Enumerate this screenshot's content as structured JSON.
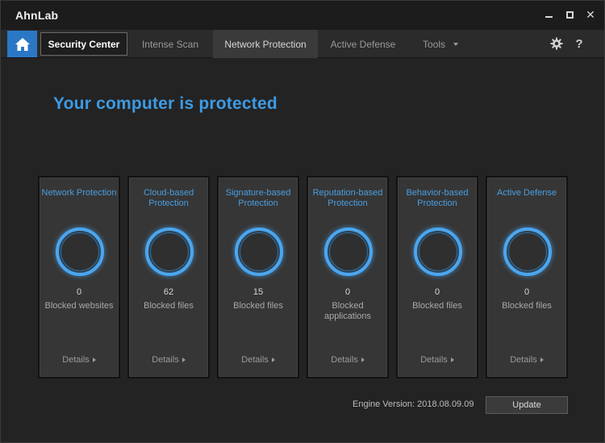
{
  "window": {
    "app_title": "AhnLab"
  },
  "nav": {
    "tabs": [
      "Security Center",
      "Intense Scan",
      "Network Protection",
      "Active Defense",
      "Tools"
    ],
    "active_tab": "Security Center",
    "hovered_tab": "Network Protection"
  },
  "main": {
    "headline": "Your computer is protected",
    "cards": [
      {
        "title": "Network Protection",
        "count": "0",
        "label": "Blocked websites",
        "details": "Details"
      },
      {
        "title": "Cloud-based Protection",
        "count": "62",
        "label": "Blocked files",
        "details": "Details"
      },
      {
        "title": "Signature-based Protection",
        "count": "15",
        "label": "Blocked files",
        "details": "Details"
      },
      {
        "title": "Reputation-based Protection",
        "count": "0",
        "label": "Blocked applications",
        "details": "Details"
      },
      {
        "title": "Behavior-based Protection",
        "count": "0",
        "label": "Blocked files",
        "details": "Details"
      },
      {
        "title": "Active Defense",
        "count": "0",
        "label": "Blocked files",
        "details": "Details"
      }
    ]
  },
  "footer": {
    "engine_label": "Engine Version:",
    "engine_version": "2018.08.09.09",
    "update_label": "Update"
  },
  "colors": {
    "accent": "#3d9be4",
    "home_button": "#2a77c6",
    "ring": "#4aa6f0"
  },
  "icons": [
    "home-icon",
    "gear-icon",
    "help-icon",
    "minimize-icon",
    "maximize-icon",
    "close-icon",
    "chevron-down-icon",
    "chevron-right-icon"
  ]
}
